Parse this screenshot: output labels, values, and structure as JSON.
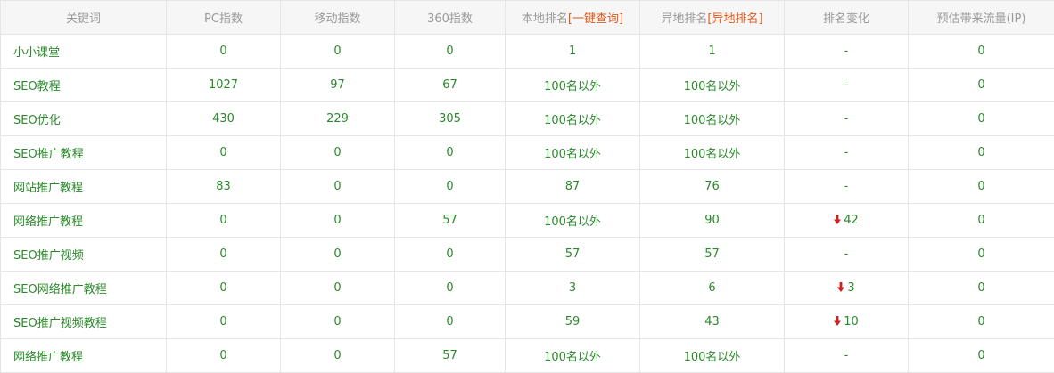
{
  "colors": {
    "header_bg": "#f6f6f6",
    "header_text": "#9a9a9a",
    "cell_text": "#2a8a2a",
    "link_orange": "#e05a1a",
    "down_red": "#cc2222",
    "border": "#e6e6e6"
  },
  "headers": {
    "keyword": "关键词",
    "pc_index": "PC指数",
    "mobile_index": "移动指数",
    "index_360": "360指数",
    "local_rank": "本地排名",
    "local_rank_link": "[一键查询]",
    "remote_rank": "异地排名",
    "remote_rank_link": "[异地排名]",
    "rank_change": "排名变化",
    "traffic": "预估带来流量(IP)"
  },
  "rows": [
    {
      "keyword": "小小课堂",
      "pc": "0",
      "mobile": "0",
      "i360": "0",
      "local": "1",
      "remote": "1",
      "change_dir": "none",
      "change": "-",
      "traffic": "0"
    },
    {
      "keyword": "SEO教程",
      "pc": "1027",
      "mobile": "97",
      "i360": "67",
      "local": "100名以外",
      "remote": "100名以外",
      "change_dir": "none",
      "change": "-",
      "traffic": "0"
    },
    {
      "keyword": "SEO优化",
      "pc": "430",
      "mobile": "229",
      "i360": "305",
      "local": "100名以外",
      "remote": "100名以外",
      "change_dir": "none",
      "change": "-",
      "traffic": "0"
    },
    {
      "keyword": "SEO推广教程",
      "pc": "0",
      "mobile": "0",
      "i360": "0",
      "local": "100名以外",
      "remote": "100名以外",
      "change_dir": "none",
      "change": "-",
      "traffic": "0"
    },
    {
      "keyword": "网站推广教程",
      "pc": "83",
      "mobile": "0",
      "i360": "0",
      "local": "87",
      "remote": "76",
      "change_dir": "none",
      "change": "-",
      "traffic": "0"
    },
    {
      "keyword": "网络推广教程",
      "pc": "0",
      "mobile": "0",
      "i360": "57",
      "local": "100名以外",
      "remote": "90",
      "change_dir": "down",
      "change": "42",
      "traffic": "0"
    },
    {
      "keyword": "SEO推广视频",
      "pc": "0",
      "mobile": "0",
      "i360": "0",
      "local": "57",
      "remote": "57",
      "change_dir": "none",
      "change": "-",
      "traffic": "0"
    },
    {
      "keyword": "SEO网络推广教程",
      "pc": "0",
      "mobile": "0",
      "i360": "0",
      "local": "3",
      "remote": "6",
      "change_dir": "down",
      "change": "3",
      "traffic": "0"
    },
    {
      "keyword": "SEO推广视频教程",
      "pc": "0",
      "mobile": "0",
      "i360": "0",
      "local": "59",
      "remote": "43",
      "change_dir": "down",
      "change": "10",
      "traffic": "0"
    },
    {
      "keyword": "网络推广教程",
      "pc": "0",
      "mobile": "0",
      "i360": "57",
      "local": "100名以外",
      "remote": "100名以外",
      "change_dir": "none",
      "change": "-",
      "traffic": "0"
    }
  ]
}
